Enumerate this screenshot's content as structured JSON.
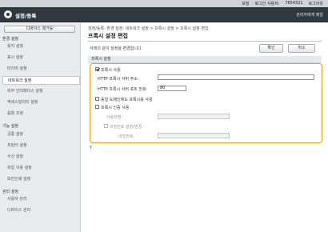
{
  "topbar": {
    "portal_link": "포털",
    "logged_in_user_label": "로그인 사용자:",
    "logged_in_user": "7654321",
    "logout": "로그아웃"
  },
  "header": {
    "title": "설정/등록",
    "portal_link": "관리자에게 메일"
  },
  "sidebar": {
    "device_button": "디바이스 제거등",
    "sections": [
      {
        "label": "환경 설정",
        "items": [
          "용지 설정",
          "표시 설정",
          "타이머 설정",
          "네트워크 설정",
          "외부 인터페이스 설정",
          "액세스빌리티 설정",
          "음향 조정"
        ]
      },
      {
        "label": "기능 설정",
        "items": [
          "공통 설정",
          "프린터 설정",
          "수신 설정",
          "파일 이용 설정",
          "보안인쇄 설정"
        ]
      },
      {
        "label": "관리 설정",
        "items": [
          "사용자 관리",
          "디바이스 관리"
        ]
      }
    ],
    "active_item": "네트워크 설정"
  },
  "main": {
    "breadcrumb": "설정/등록: 환경 설정: 네트워크 설정 > 프록시 설정 > 프록시 설정 편집",
    "page_title": "프록시 설정 편집",
    "description": "아래의 같이 설정을 변경합니다.",
    "ok_button": "확인",
    "cancel_button": "취소",
    "section_title": "프록시 설정",
    "use_proxy": {
      "label": "프록시 사용",
      "checked": true
    },
    "http_address": {
      "label": "HTTP 프록시 서버 주소:",
      "value": ""
    },
    "http_port": {
      "label": "HTTP 프록시 서버 포트 번호:",
      "value": "80"
    },
    "same_domain": {
      "label": "동일 도메인에도 프록시를 사용",
      "checked": false
    },
    "use_auth": {
      "label": "프록시 인증 사용",
      "checked": false
    },
    "username": {
      "label": "사용자명:",
      "value": ""
    },
    "set_password": {
      "label": "비밀번호 설정/변경",
      "checked": false
    },
    "password": {
      "label": "비밀번호:",
      "value": ""
    },
    "top_link": "⤒"
  }
}
